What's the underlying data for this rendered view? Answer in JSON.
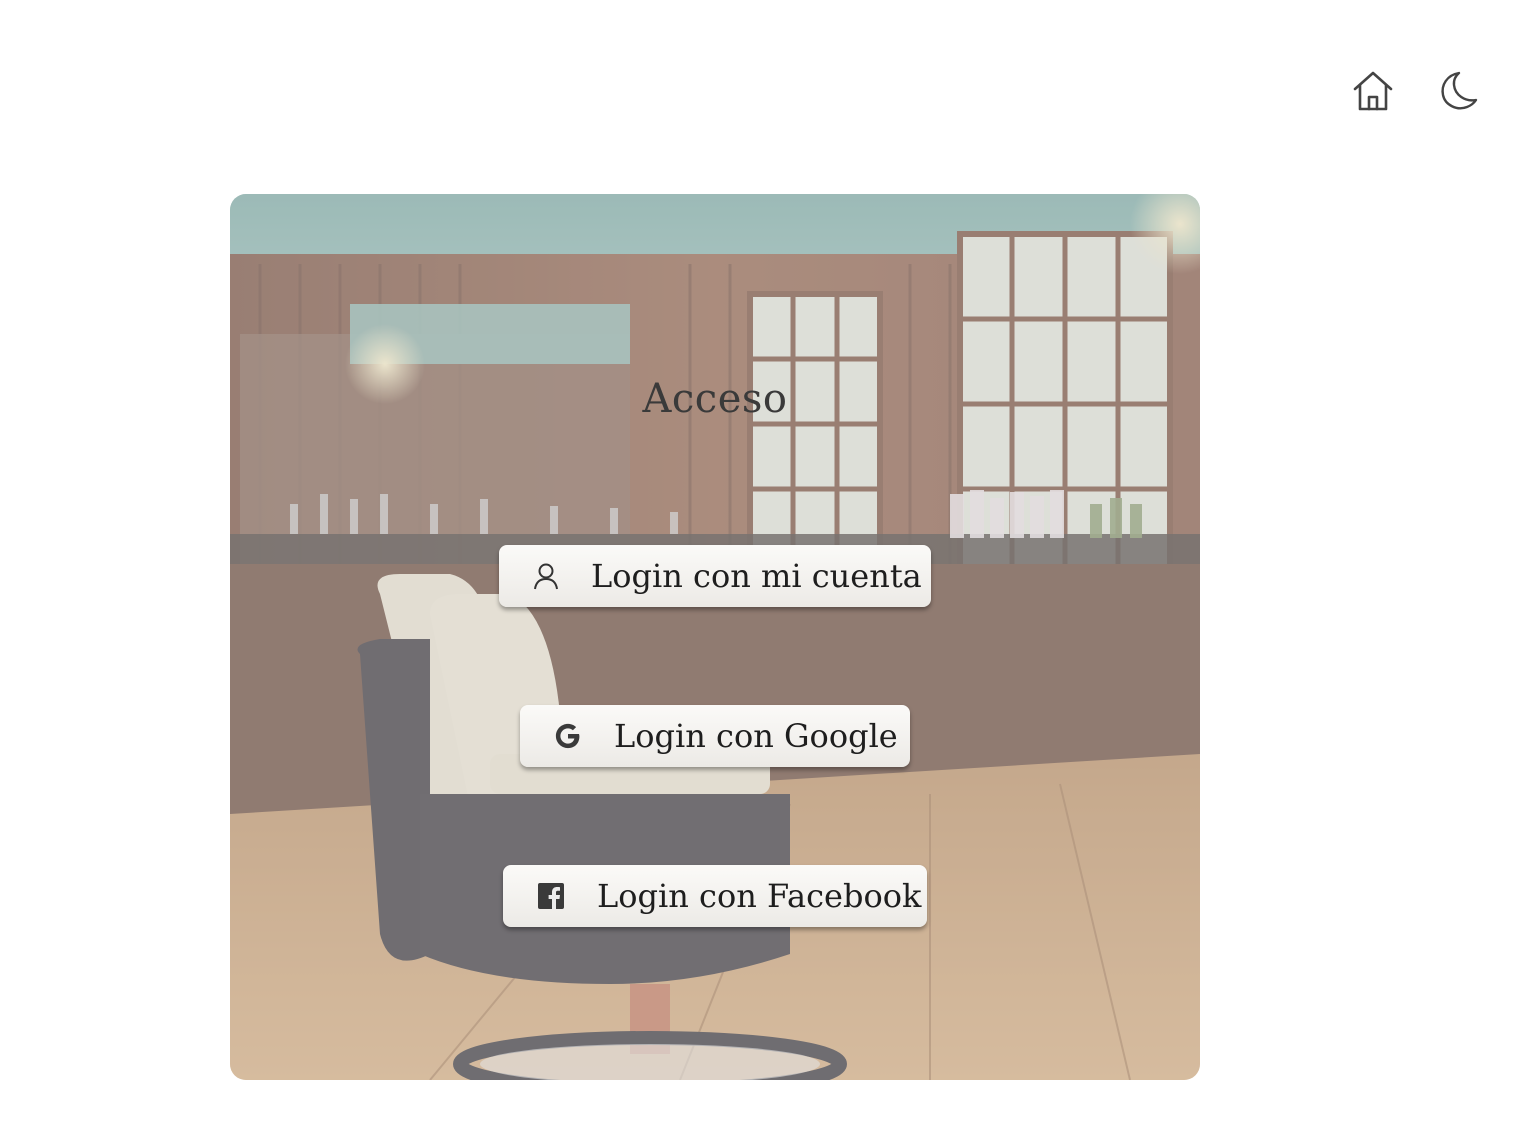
{
  "header": {
    "icons": [
      "home-icon",
      "moon-icon"
    ]
  },
  "card": {
    "title": "Acceso",
    "buttons": [
      {
        "label": "Login con mi cuenta",
        "icon": "user-icon"
      },
      {
        "label": "Login con Google",
        "icon": "google-icon"
      },
      {
        "label": "Login con Facebook",
        "icon": "facebook-icon"
      }
    ]
  },
  "colors": {
    "text": "#1e1e1e",
    "icon": "#444444",
    "overlay": "#d2d2d2"
  }
}
